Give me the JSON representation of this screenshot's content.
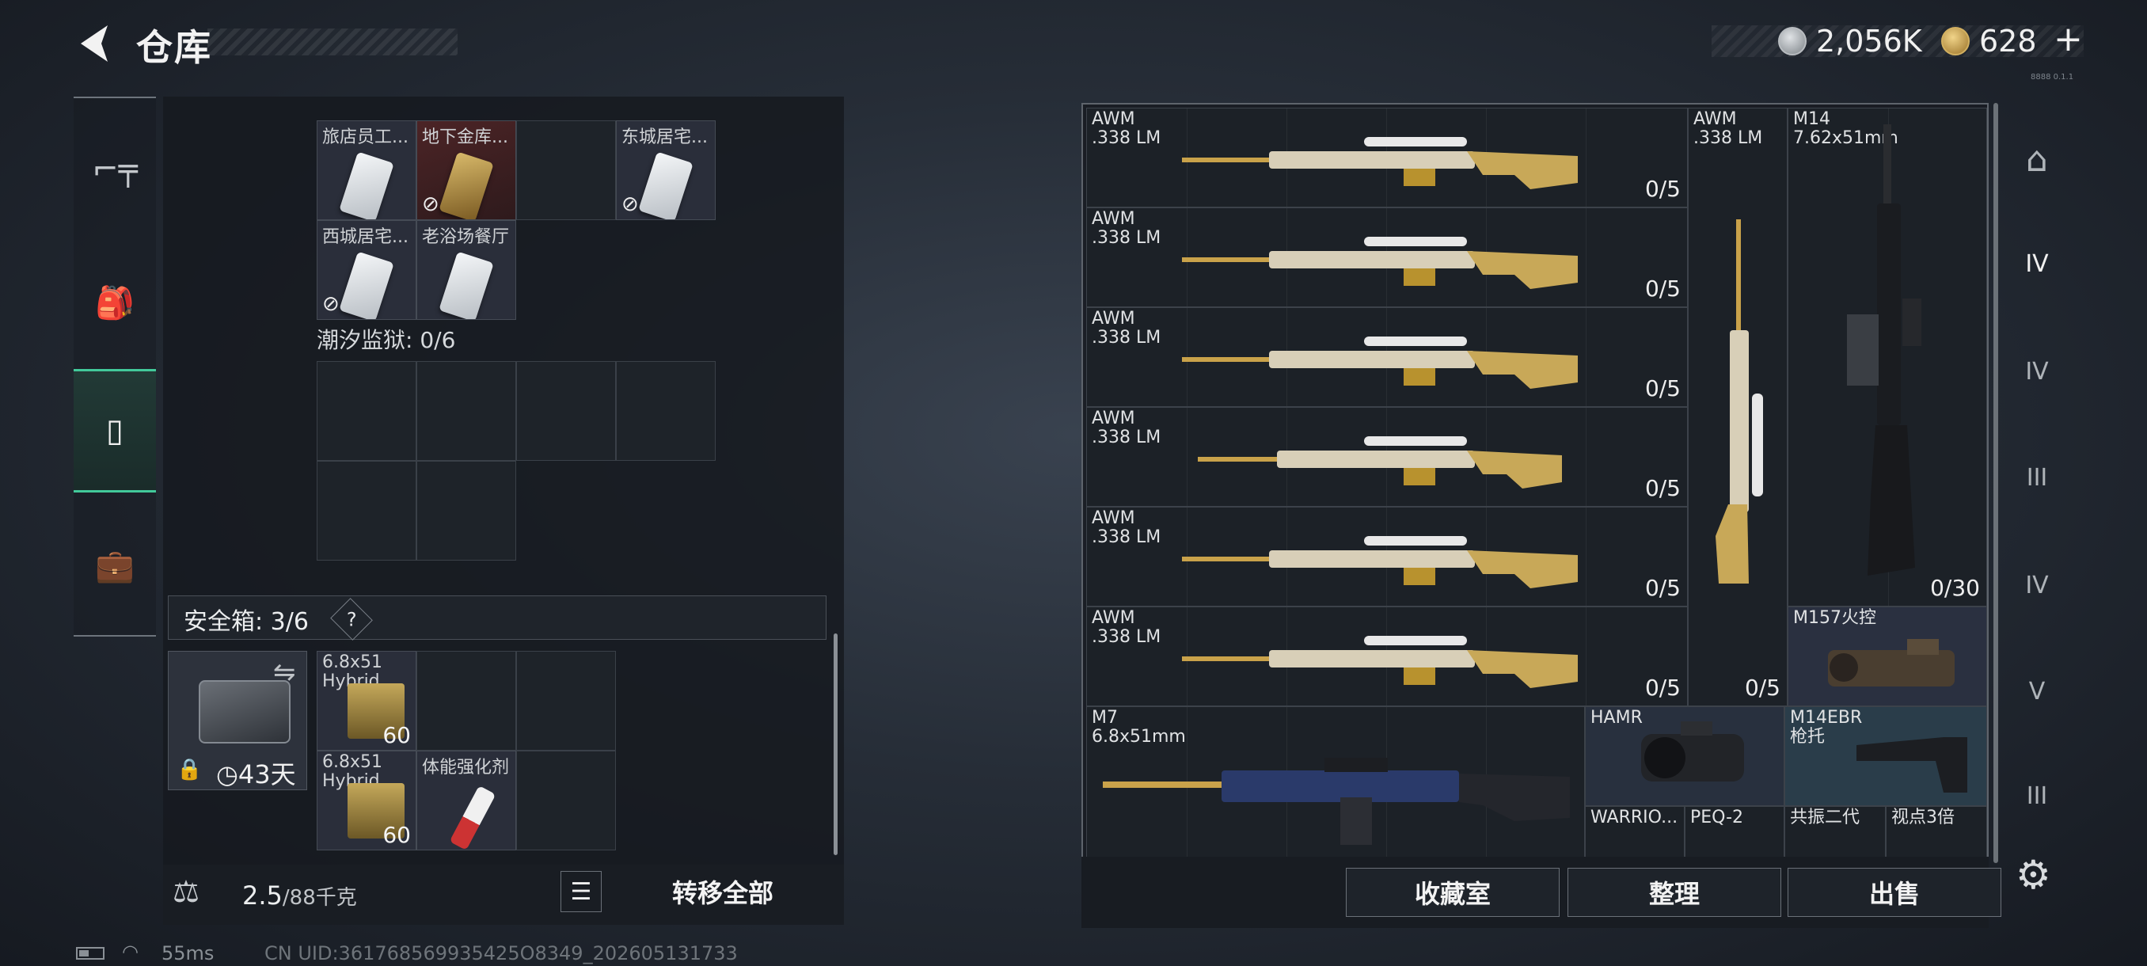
{
  "header": {
    "title": "仓库",
    "currency": {
      "silver": "2,056K",
      "gold": "628",
      "add": "+"
    }
  },
  "left_nav": {
    "items": [
      {
        "name": "weapon"
      },
      {
        "name": "backpack"
      },
      {
        "name": "container"
      },
      {
        "name": "briefcase"
      }
    ]
  },
  "keys_section": {
    "row1": [
      "旅店员工...",
      "地下金库...",
      "东城居宅..."
    ],
    "row2": [
      "西城居宅...",
      "老浴场餐厅"
    ],
    "prison_label": "潮汐监狱: 0/6"
  },
  "secure": {
    "label": "安全箱: 3/6",
    "help": "?",
    "days": "43天",
    "items": [
      {
        "name": "6.8x51\nHybrid",
        "qty": "60"
      },
      {
        "name": "6.8x51\nHybrid",
        "qty": "60"
      },
      {
        "name": "体能强化剂"
      }
    ]
  },
  "bottom": {
    "weight": "2.5",
    "weight_max": "/88千克",
    "transfer": "转移全部"
  },
  "status": {
    "ping": "55ms",
    "uid": "CN UID:361768569935425O8349_202605131733"
  },
  "weapons": {
    "awm": [
      {
        "name": "AWM\n.338 LM",
        "count": "0/5"
      },
      {
        "name": "AWM\n.338 LM",
        "count": "0/5"
      },
      {
        "name": "AWM\n.338 LM",
        "count": "0/5"
      },
      {
        "name": "AWM\n.338 LM",
        "count": "0/5"
      },
      {
        "name": "AWM\n.338 LM",
        "count": "0/5"
      },
      {
        "name": "AWM\n.338 LM",
        "count": "0/5"
      }
    ],
    "awm_vertical": {
      "name": "AWM\n.338 LM",
      "count": "0/5"
    },
    "m14": {
      "name": "M14\n7.62x51mm",
      "count": "0/30"
    },
    "m157": {
      "name": "M157火控"
    },
    "m7": {
      "name": "M7\n6.8x51mm"
    },
    "hamr": {
      "name": "HAMR"
    },
    "m14ebr": {
      "name": "M14EBR\n枪托"
    },
    "bottom_row": [
      "WARRIO...",
      "PEQ-2",
      "共振二代",
      "视点3倍"
    ]
  },
  "actions": {
    "collection": "收藏室",
    "sort": "整理",
    "sell": "出售"
  },
  "right_nav": {
    "levels": [
      "IV",
      "IV",
      "III",
      "IV",
      "V",
      "III"
    ]
  },
  "tiny": "8888 0.1.1"
}
